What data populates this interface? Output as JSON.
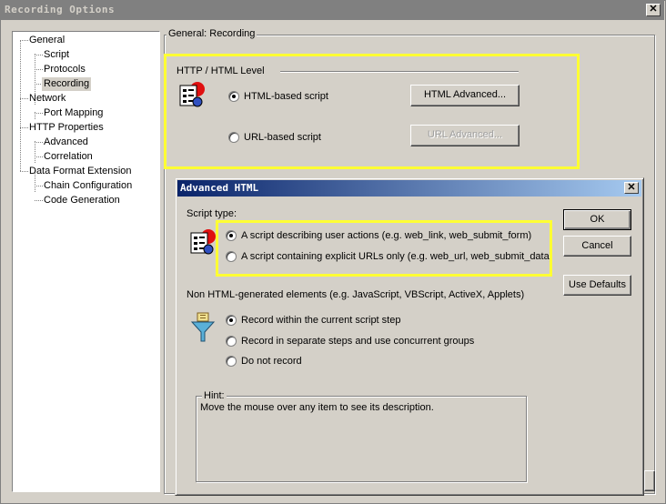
{
  "outer_window": {
    "title": "Recording Options",
    "close_glyph": "✕"
  },
  "tree": {
    "items": [
      {
        "label": "General",
        "level": 0
      },
      {
        "label": "Script",
        "level": 1
      },
      {
        "label": "Protocols",
        "level": 1
      },
      {
        "label": "Recording",
        "level": 1,
        "selected": true
      },
      {
        "label": "Network",
        "level": 0
      },
      {
        "label": "Port Mapping",
        "level": 1
      },
      {
        "label": "HTTP Properties",
        "level": 0
      },
      {
        "label": "Advanced",
        "level": 1
      },
      {
        "label": "Correlation",
        "level": 1
      },
      {
        "label": "Data Format Extension",
        "level": 0
      },
      {
        "label": "Chain Configuration",
        "level": 1
      },
      {
        "label": "Code Generation",
        "level": 1
      }
    ]
  },
  "main": {
    "group_title": "General: Recording",
    "level_title": "HTTP / HTML Level",
    "options": [
      {
        "label": "HTML-based script",
        "selected": true
      },
      {
        "label": "URL-based script",
        "selected": false
      }
    ],
    "html_advanced_label": "HTML Advanced...",
    "url_advanced_label": "URL Advanced..."
  },
  "dialog": {
    "title": "Advanced HTML",
    "close_glyph": "✕",
    "script_type_label": "Script type:",
    "script_options": [
      {
        "label": "A script describing user actions (e.g. web_link, web_submit_form)",
        "selected": true
      },
      {
        "label": "A script containing explicit URLs only (e.g. web_url, web_submit_data)",
        "selected": false
      }
    ],
    "non_html_label": "Non HTML-generated elements (e.g. JavaScript, VBScript, ActiveX, Applets)",
    "non_html_options": [
      {
        "label": "Record within the current script step",
        "selected": true
      },
      {
        "label": "Record in separate steps and use concurrent groups",
        "selected": false
      },
      {
        "label": "Do not record",
        "selected": false
      }
    ],
    "hint_title": "Hint:",
    "hint_text": "Move the mouse over any item to see its description.",
    "ok_label": "OK",
    "cancel_label": "Cancel",
    "defaults_label": "Use Defaults"
  },
  "colors": {
    "highlight": "#ffff33",
    "titlebar_active": "#0a246a",
    "window_face": "#d4d0c8"
  }
}
